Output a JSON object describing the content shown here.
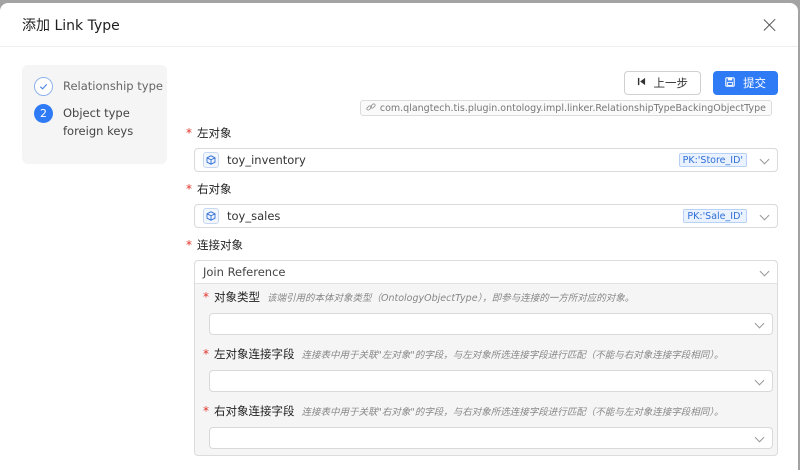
{
  "background": {
    "fragment": "0"
  },
  "modal": {
    "title": "添加 Link Type"
  },
  "steps": [
    {
      "label": "Relationship type",
      "status": "done"
    },
    {
      "number": "2",
      "label_line1": "Object type",
      "label_line2": "foreign keys",
      "status": "active"
    }
  ],
  "toolbar": {
    "prev_label": "上一步",
    "submit_label": "提交"
  },
  "classpath": "com.qlangtech.tis.plugin.ontology.impl.linker.RelationshipTypeBackingObjectType",
  "fields": {
    "left": {
      "label": "左对象",
      "value": "toy_inventory",
      "pk": "PK:'Store_ID'"
    },
    "right": {
      "label": "右对象",
      "value": "toy_sales",
      "pk": "PK:'Sale_ID'"
    },
    "join": {
      "label": "连接对象",
      "value": "Join Reference"
    }
  },
  "join_fields": [
    {
      "label": "对象类型",
      "hint": "该端引用的本体对象类型（OntologyObjectType），即参与连接的一方所对应的对象。",
      "value": ""
    },
    {
      "label": "左对象连接字段",
      "hint": "连接表中用于关联\"左对象\"的字段，与左对象所选连接字段进行匹配（不能与右对象连接字段相同）。",
      "value": ""
    },
    {
      "label": "右对象连接字段",
      "hint": "连接表中用于关联\"右对象\"的字段，与右对象所选连接字段进行匹配（不能与左对象连接字段相同）。",
      "value": ""
    }
  ],
  "colors": {
    "primary": "#2f7bf5",
    "required": "#e0342b",
    "pk_tag": "#2f6fd6"
  }
}
